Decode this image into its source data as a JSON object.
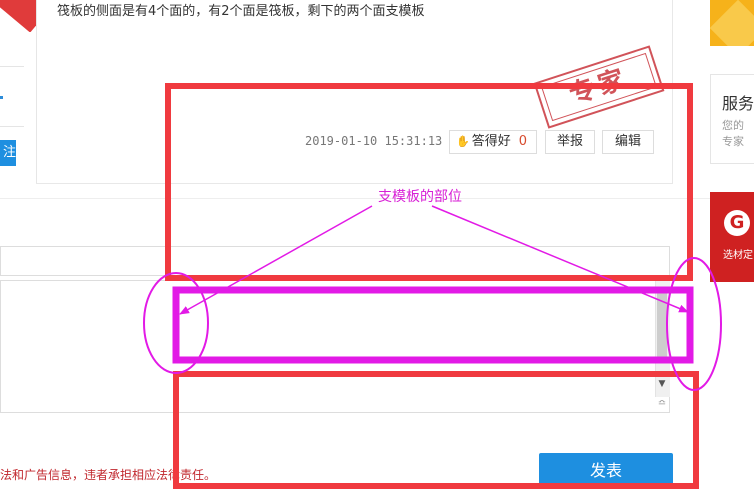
{
  "post": {
    "text": "筏板的侧面是有4个面的，有2个面是筏板，剩下的两个面支模板",
    "timestamp": "2019-01-10 15:31:13",
    "good_answer_label": "答得好",
    "good_answer_count": "0",
    "report_label": "举报",
    "edit_label": "编辑",
    "expert_stamp": "专家"
  },
  "left_panel": {
    "button_label": "注"
  },
  "annotation": {
    "label": "支模板的部位"
  },
  "reply": {
    "notice": "法和广告信息，违者承担相应法律责任。",
    "submit_label": "发表"
  },
  "right_sidebar": {
    "service_title": "服务",
    "service_desc": "您的专家",
    "ad_text": "选材定"
  },
  "colors": {
    "accent_blue": "#1e8fe0",
    "annotation_red": "#f03a3f",
    "annotation_magenta": "#e21ae6",
    "stamp_red": "#c9363d"
  }
}
